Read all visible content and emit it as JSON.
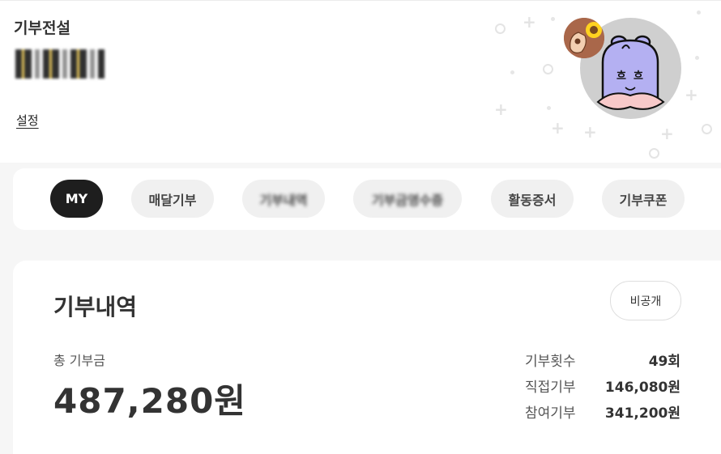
{
  "profile": {
    "rank_title": "기부전설",
    "nickname": "tjd",
    "settings_label": "설정"
  },
  "tabs": [
    {
      "label": "MY"
    },
    {
      "label": "매달기부"
    },
    {
      "label": "기부내역"
    },
    {
      "label": "기부금영수증"
    },
    {
      "label": "활동증서"
    },
    {
      "label": "기부쿠폰"
    }
  ],
  "donation": {
    "title": "기부내역",
    "private_button": "비공개",
    "total_label": "총 기부금",
    "total_amount": "487,280원",
    "stats": [
      {
        "label": "기부횟수",
        "value": "49회"
      },
      {
        "label": "직접기부",
        "value": "146,080원"
      },
      {
        "label": "참여기부",
        "value": "341,200원"
      }
    ]
  },
  "colors": {
    "active_tab": "#1e1e1e",
    "tab_bg": "#f0f0f0",
    "avatar_bg": "#cfcfcf",
    "character": "#b4b0f2"
  }
}
